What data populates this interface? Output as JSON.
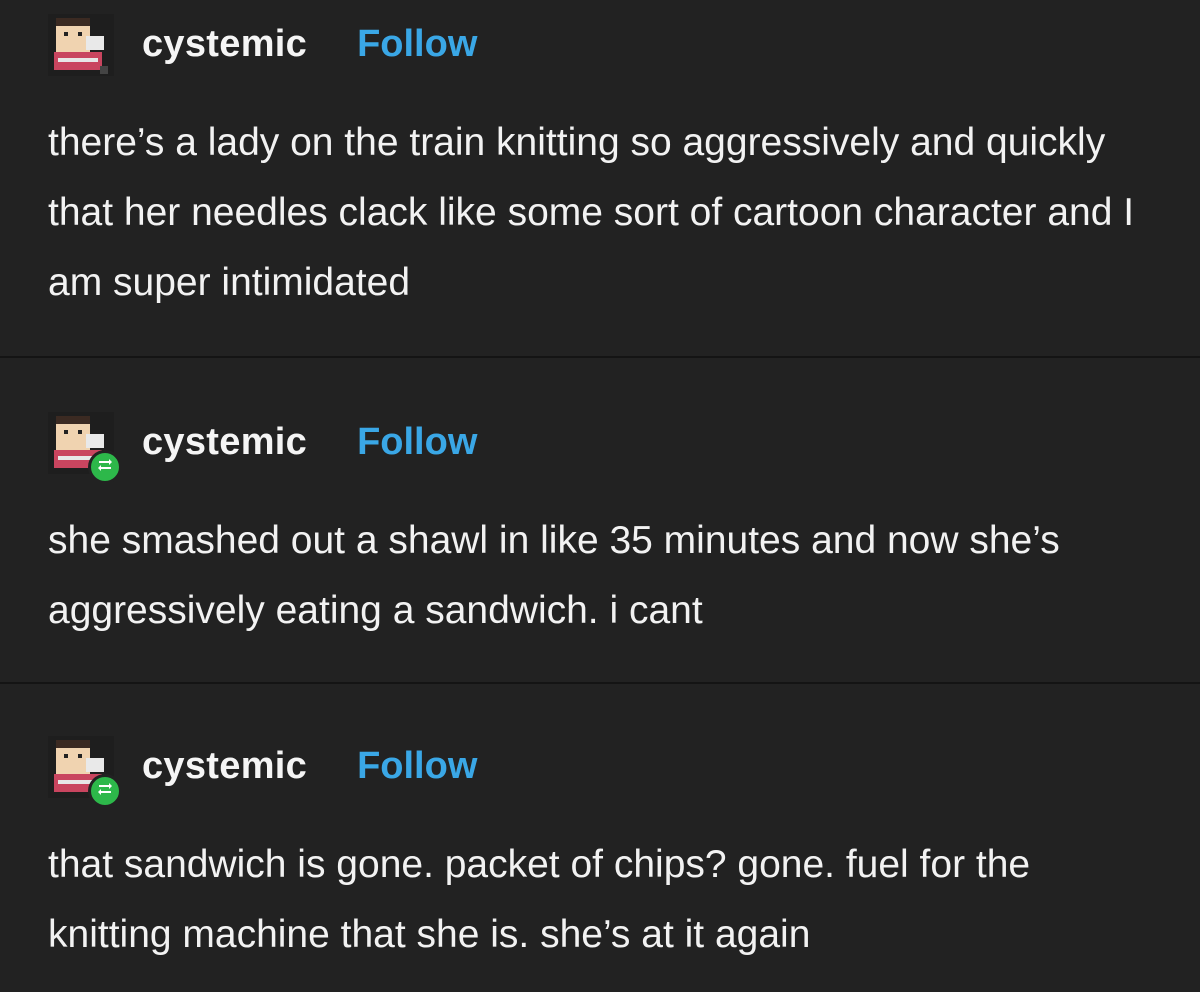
{
  "colors": {
    "background": "#222222",
    "text": "#f2f2f2",
    "follow_link": "#3aa7e6",
    "reblog_badge": "#2db84a"
  },
  "posts": [
    {
      "username": "cystemic",
      "follow_label": "Follow",
      "reblogged": false,
      "text": "there’s a lady on the train knitting so aggressively and quickly that her needles clack like some sort of cartoon character and I am super intimidated"
    },
    {
      "username": "cystemic",
      "follow_label": "Follow",
      "reblogged": true,
      "text": "she smashed out a shawl in like 35 minutes and now she’s aggressively eating a sandwich. i cant"
    },
    {
      "username": "cystemic",
      "follow_label": "Follow",
      "reblogged": true,
      "text": "that sandwich is gone. packet of chips? gone. fuel for the knitting machine that she is. she’s at it again"
    }
  ]
}
